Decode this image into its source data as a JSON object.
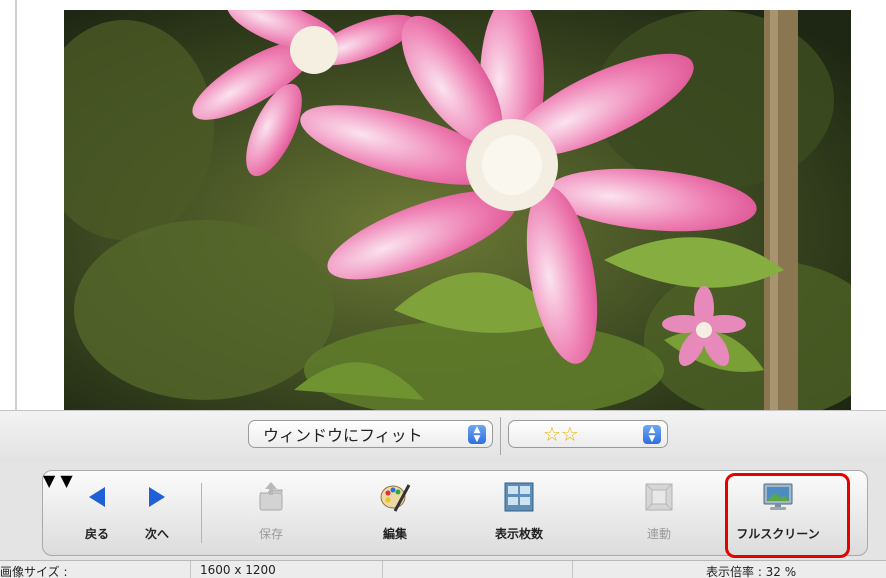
{
  "zoom": {
    "fit_label": "ウィンドウにフィット",
    "rating_stars": "☆☆"
  },
  "toolbar": {
    "back_label": "戻る",
    "next_label": "次へ",
    "save_label": "保存",
    "edit_label": "編集",
    "display_count_label": "表示枚数",
    "link_label": "連動",
    "fullscreen_label": "フルスクリーン"
  },
  "status": {
    "image_size_label": "画像サイズ :",
    "image_size_value": "1600 x 1200",
    "zoom_ratio": "表示倍率 : 32 %"
  },
  "colors": {
    "accent": "#e60000",
    "arrow_blue": "#1f5fd8",
    "stepper_blue": "#2f6ee0"
  },
  "icons": [
    "back-arrow-icon",
    "next-arrow-icon",
    "save-folder-icon",
    "edit-palette-icon",
    "display-count-icon",
    "link-icon",
    "fullscreen-icon"
  ]
}
